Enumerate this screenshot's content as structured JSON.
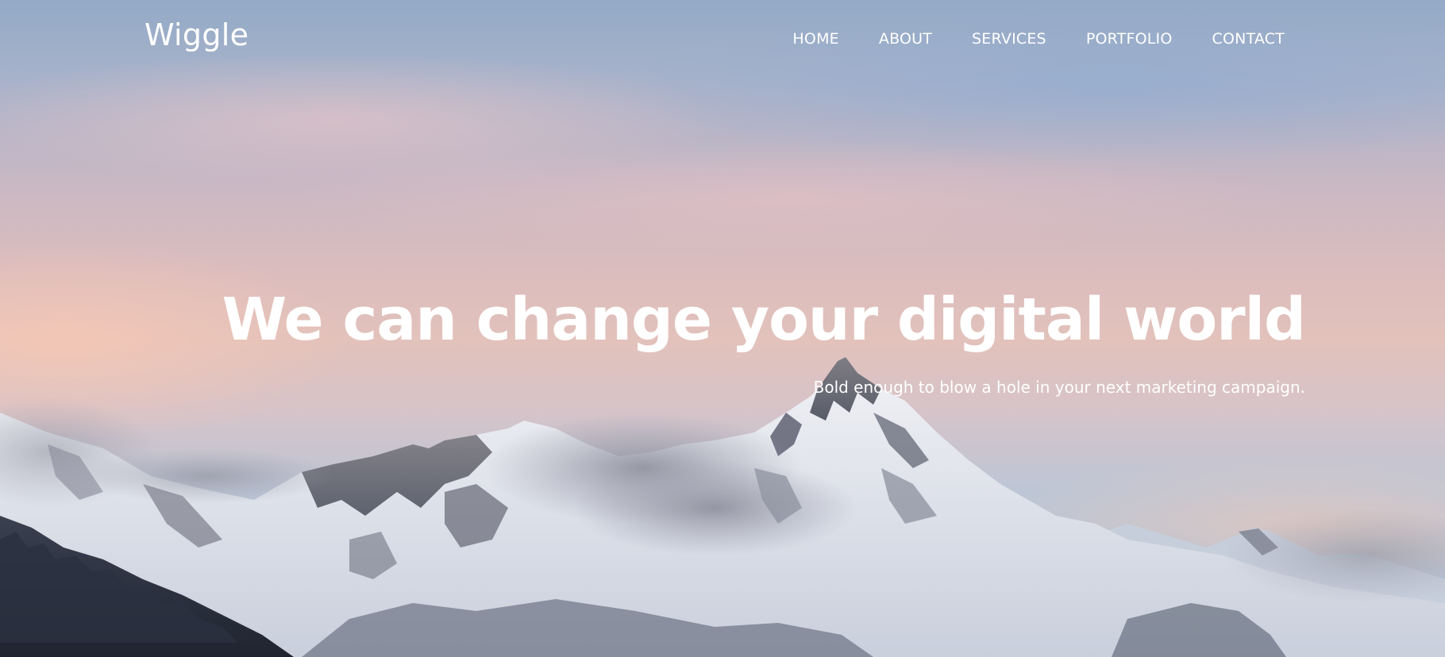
{
  "brand": {
    "name": "Wiggle"
  },
  "nav": {
    "items": [
      {
        "label": "HOME"
      },
      {
        "label": "ABOUT"
      },
      {
        "label": "SERVICES"
      },
      {
        "label": "PORTFOLIO"
      },
      {
        "label": "CONTACT"
      }
    ]
  },
  "hero": {
    "headline": "We can change your digital world",
    "subheadline": "Bold enough to blow a hole in your next marketing campaign.",
    "background_image": "mountain-peaks-at-dusk"
  },
  "colors": {
    "text": "#ffffff",
    "snow": "#eef1f6",
    "rock": "#5b5c67",
    "forest": "#2b3140"
  }
}
